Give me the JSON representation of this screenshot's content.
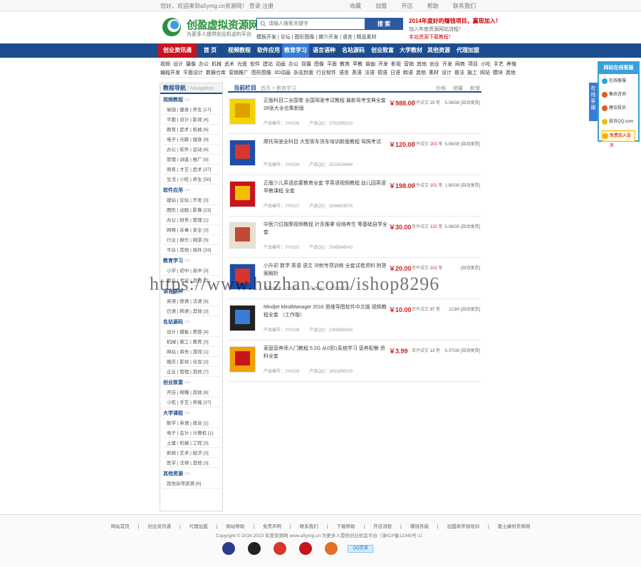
{
  "topbar": {
    "welcome": "您好，欢迎来到a5ymg.cn资源网！ 登录  注册",
    "links": [
      "收藏",
      "加盟",
      "开店",
      "帮助",
      "联系我们"
    ]
  },
  "header": {
    "logo_title": "创盈虚拟资源网",
    "logo_sub": "为更多人提供创业机会的平台",
    "search_placeholder": "请输入搜索关键字",
    "search_button": "搜 索",
    "hot_keys": "模板开发 | 论坛 | 图形图像 | 媒介开发 | 语言 | 精品素材",
    "promo_line1": "2014年度好的赚钱项目，赢现加入！",
    "promo_line2": "加入年度资源网站流程！",
    "promo_line3": "本站资源下载教程！"
  },
  "nav": {
    "items": [
      "创业资讯通",
      "首 页",
      "视频教程",
      "软件应用",
      "教育学习",
      "语言语种",
      "名站源码",
      "创业致富",
      "大学教材",
      "其他资源",
      "代理加盟"
    ],
    "active_index": 4
  },
  "subnav": {
    "row1": [
      "视频",
      "设计",
      "摄像",
      "办公",
      "机械",
      "武术",
      "光盘",
      "软件",
      "建站",
      "动画",
      "办公",
      "双摄",
      "图像",
      "平面",
      "教育",
      "早教",
      "瑜伽",
      "开发",
      "影视",
      "营销",
      "其他",
      "创业",
      "开发",
      "网商",
      "项目",
      "小吃",
      "手艺",
      "养殖"
    ],
    "row2": [
      "编程开发",
      "平面设计",
      "数据仓库",
      "营销推广",
      "图形图像",
      "3D动画",
      "杂志封面",
      "行业软件",
      "语言",
      "英语",
      "法语",
      "德语",
      "日语",
      "韩语",
      "其他",
      "素材",
      "设计",
      "普法",
      "施工",
      "网站",
      "模块",
      "其他"
    ]
  },
  "sidebar": {
    "title": "教程导航",
    "title_en": "/ Navigation",
    "categories": [
      {
        "title": "视频教程",
        "rows": [
          "瑜伽 | 健身 | 养生 [17]",
          "平面 | 设计 | 影视 [4]",
          "教育 | 武术 | 机械 [6]",
          "电子 | 光碟 | 健身 [9]",
          "办公 | 软件 | 运动 [6]",
          "管理 | 讲座 | 推广 [9]",
          "商务 | 才艺 | 武术 [37]",
          "生活 | 小吃 | 养生 [50]"
        ]
      },
      {
        "title": "软件应用",
        "rows": [
          "建站 | 论坛 | 开发 [3]",
          "图形 | 动画 | 影像 [23]",
          "办公 | 财务 | 管理 [1]",
          "网络 | 杀毒 | 安全 [3]",
          "行业 | 娱乐 | 网游 [5]",
          "平台 | 其他 | 插件 [33]"
        ]
      },
      {
        "title": "教育学习",
        "rows": [
          "小学 | 初中 | 高中 [3]",
          "职业 | 考证 | 其他 [2]"
        ]
      },
      {
        "title": "语言语种",
        "rows": [
          "英语 | 德语 | 法语 [6]",
          "日语 | 韩语 | 其他 [3]"
        ]
      },
      {
        "title": "名站源码",
        "rows": [
          "设计 | 模板 | 美容 [4]",
          "机械 | 施工 | 教育 [3]",
          "网站 | 商务 | 游戏 [1]",
          "婚庆 | 影视 | 化妆 [3]",
          "企业 | 管理 | 其他 [7]"
        ]
      },
      {
        "title": "创业致富",
        "rows": [
          "开店 | 网赚 | 其他 [6]",
          "小吃 | 手艺 | 养殖 [37]"
        ]
      },
      {
        "title": "大学课程",
        "rows": [
          "数学 | 英语 | 政治 [1]",
          "电子 | 会计 | 计算机 [1]",
          "土建 | 机械 | 工程 [3]",
          "新闻 | 艺术 | 经济 [3]",
          "医学 | 法律 | 其他 [3]"
        ]
      },
      {
        "title": "其他资源",
        "rows": [
          "其他杂项资源 [6]"
        ]
      }
    ]
  },
  "main": {
    "title": "当前栏目",
    "crumb": "首页 > 教育学习",
    "sort": [
      "价格",
      "销量",
      "新增"
    ],
    "products": [
      {
        "title": "正版科目二全国卷 全国驾驶考试教程 最新驾考宝典全套28张大全合集新版",
        "code": "产品编号：JY0106",
        "qq": "产品QQ：1752385010",
        "price": "￥988.00",
        "sales_label": "单件成交",
        "sales": "23",
        "unit": "笔",
        "size": "5.06GB",
        "delivery": "[自动发货]"
      },
      {
        "title": "摩托驾驶全科目 大型客车货车培训新版教程 驾照考试",
        "code": "产品编号：JY0104",
        "qq": "产品QQ：1513428489",
        "price": "￥120.00",
        "sales_label": "单件成交",
        "sales": "203",
        "unit": "笔",
        "size": "5.56GB",
        "delivery": "[自动发货]"
      },
      {
        "title": "正版少儿英语启蒙教育全套 学英语视频教程 幼儿园英语早教课程 全套",
        "code": "产品编号：JY0107",
        "qq": "产品QQ：1546893076",
        "price": "￥198.00",
        "sales_label": "单件成交",
        "sales": "101",
        "unit": "笔",
        "size": "1.80GB",
        "delivery": "[自动发货]"
      },
      {
        "title": "中医穴位按摩视频教程 针灸推拿 经络养生 零基础自学全套",
        "code": "产品编号：JY0102",
        "qq": "产品QQ：2048348043",
        "price": "￥30.00",
        "sales_label": "单件成交",
        "sales": "120",
        "unit": "笔",
        "size": "5.06GB",
        "delivery": "[自动发货]"
      },
      {
        "title": "小升初 数学 英语 语文 冲刺专项训练 全套试卷资料 附答案解析",
        "code": "产品编号：JY0100",
        "qq": "产品QQ：2293365107",
        "price": "￥20.00",
        "sales_label": "单件成交",
        "sales": "102",
        "unit": "笔",
        "size": "",
        "delivery": "[自动发货]"
      },
      {
        "title": "Mindjet MindManager 2016 思维导图软件中文版 视频教程全套 （工作版）",
        "code": "产品编号：JY0108",
        "qq": "产品QQ：1369340443",
        "price": "￥10.00",
        "sales_label": "单件成交",
        "sales": "97",
        "unit": "笔",
        "size": "213M",
        "delivery": "[自动发货]"
      },
      {
        "title": "家庭营养师入门教程 5.2G 从0到1系统学习 营养配餐 资料全套",
        "code": "产品编号：JY0103",
        "qq": "产品QQ：1631858100",
        "price": "￥3.99",
        "sales_label": "单件成交",
        "sales": "13",
        "unit": "笔",
        "size": "5.37GB",
        "delivery": "[自动发货]"
      }
    ]
  },
  "float": {
    "tab": "在线客服",
    "header": "网站在线客服",
    "items": [
      "在线客服",
      "售后咨询",
      "建议投诉",
      "投诉QQ:com"
    ],
    "join": "免费加入会员"
  },
  "footer": {
    "links": [
      "网站首页",
      "创业资讯通",
      "代理加盟",
      "网站帮助",
      "免责声明",
      "联系我们",
      "下载帮助",
      "开店流程",
      "赚钱答疑",
      "加盟商常规培训",
      "富士康供货商网"
    ],
    "copyright": "Copyright © 2016-2023 年度资源网 www.a5ymg.cn 为更多人提供创业机会平台（浙ICP备12345号-1）",
    "qq_badge": "QQ交谈"
  },
  "watermark": "https://www.huzhan.com/ishop8296",
  "colors": {
    "nav": "#1d4d8f",
    "accent_red": "#c8141e",
    "price": "#d21e1e",
    "float": "#3aa0d9"
  }
}
